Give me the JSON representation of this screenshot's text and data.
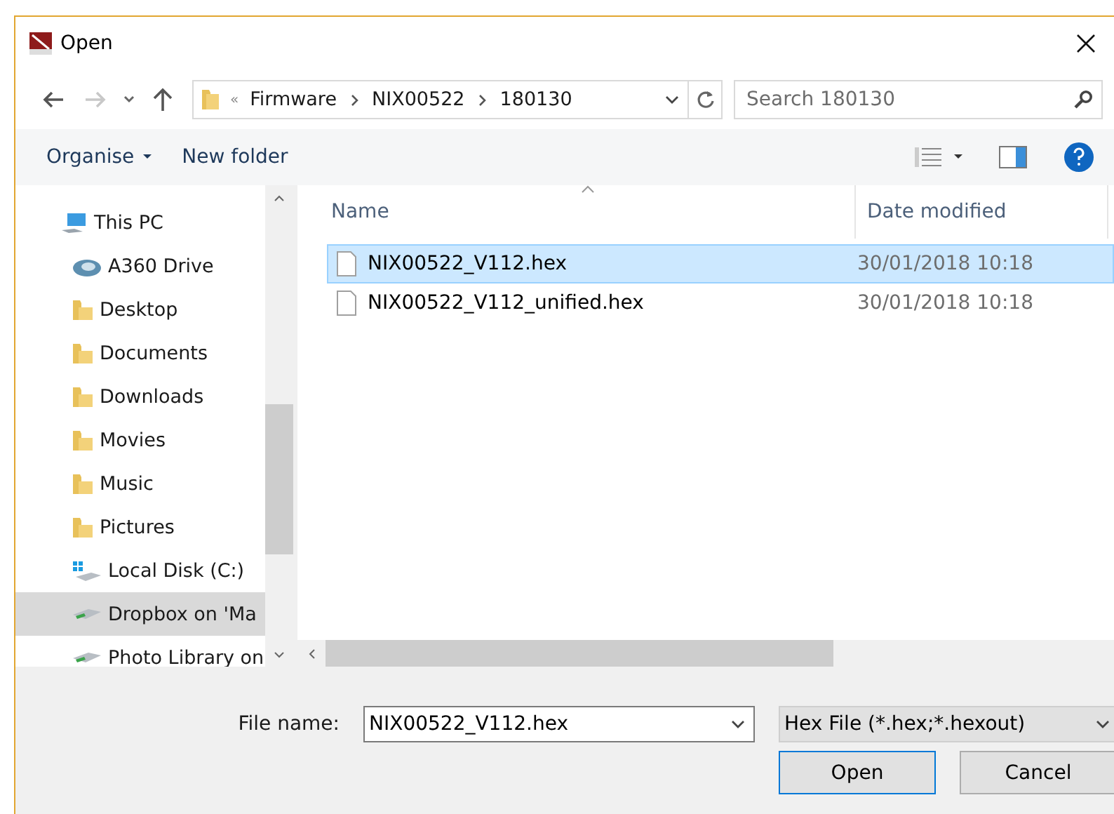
{
  "window": {
    "title": "Open"
  },
  "navigation": {
    "breadcrumb": [
      {
        "label": "«",
        "kind": "overflow"
      },
      {
        "label": "Firmware",
        "kind": "folder"
      },
      {
        "label": "NIX00522",
        "kind": "folder"
      },
      {
        "label": "180130",
        "kind": "folder"
      }
    ],
    "search": {
      "placeholder": "Search 180130"
    }
  },
  "toolbar": {
    "buttons": [
      {
        "label": "Organise",
        "dropdown": true
      },
      {
        "label": "New folder",
        "dropdown": false
      }
    ]
  },
  "sidebar": {
    "items": [
      {
        "label": "This PC",
        "kind": "computer",
        "selected": false,
        "children": [
          {
            "label": "A360 Drive",
            "kind": "cloud",
            "selected": false
          },
          {
            "label": "Desktop",
            "kind": "folder",
            "selected": false
          },
          {
            "label": "Documents",
            "kind": "folder",
            "selected": false
          },
          {
            "label": "Downloads",
            "kind": "folder",
            "selected": false
          },
          {
            "label": "Movies",
            "kind": "folder",
            "selected": false
          },
          {
            "label": "Music",
            "kind": "folder",
            "selected": false
          },
          {
            "label": "Pictures",
            "kind": "folder",
            "selected": false
          },
          {
            "label": "Local Disk (C:)",
            "kind": "disk",
            "selected": false
          },
          {
            "label": "Dropbox on 'Ma",
            "kind": "network",
            "selected": true
          },
          {
            "label": "Photo Library on",
            "kind": "network",
            "selected": false
          }
        ]
      }
    ]
  },
  "table": {
    "columns": [
      "Name",
      "Date modified"
    ],
    "rows": [
      {
        "name": "NIX00522_V112.hex",
        "date": "30/01/2018 10:18",
        "selected": true
      },
      {
        "name": "NIX00522_V112_unified.hex",
        "date": "30/01/2018 10:18",
        "selected": false
      }
    ]
  },
  "footer": {
    "file_name_label": "File name:",
    "file_name": "NIX00522_V112.hex",
    "file_type": "Hex File (*.hex;*.hexout)",
    "buttons": [
      {
        "label": "Open",
        "default": true
      },
      {
        "label": "Cancel",
        "default": false
      }
    ]
  }
}
